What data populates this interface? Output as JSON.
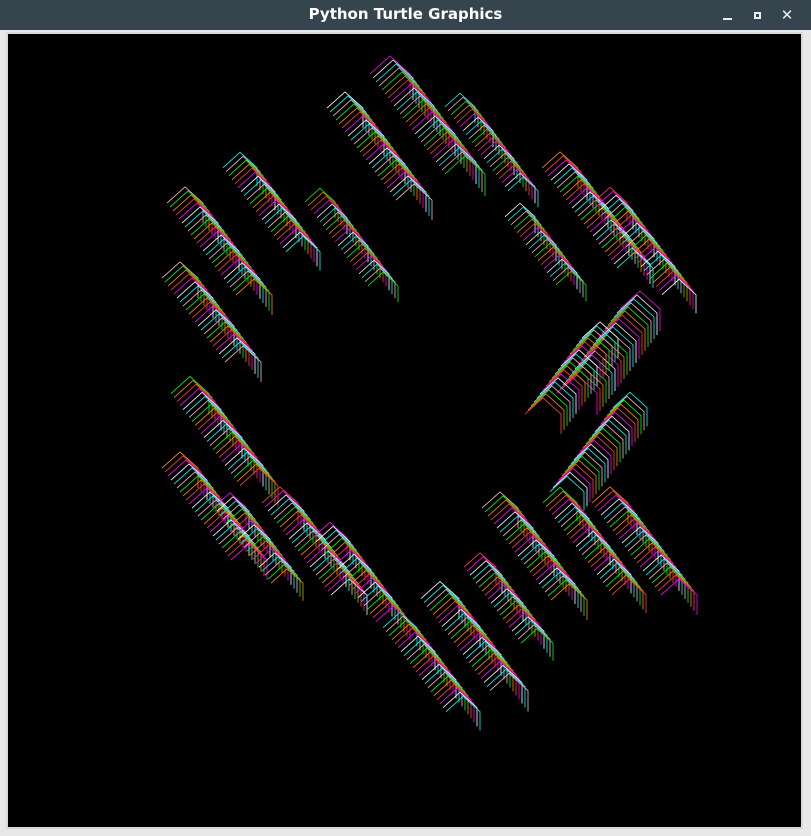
{
  "window": {
    "title": "Python Turtle Graphics",
    "controls": [
      "minimize-icon",
      "maximize-icon",
      "close-icon"
    ]
  },
  "canvas": {
    "background": "#000000",
    "pen_colors": [
      "#ff00ff",
      "#ffffff",
      "#00ffff",
      "#ffb6c1",
      "#00ff00",
      "#ff8c00",
      "#ff4040"
    ]
  }
}
